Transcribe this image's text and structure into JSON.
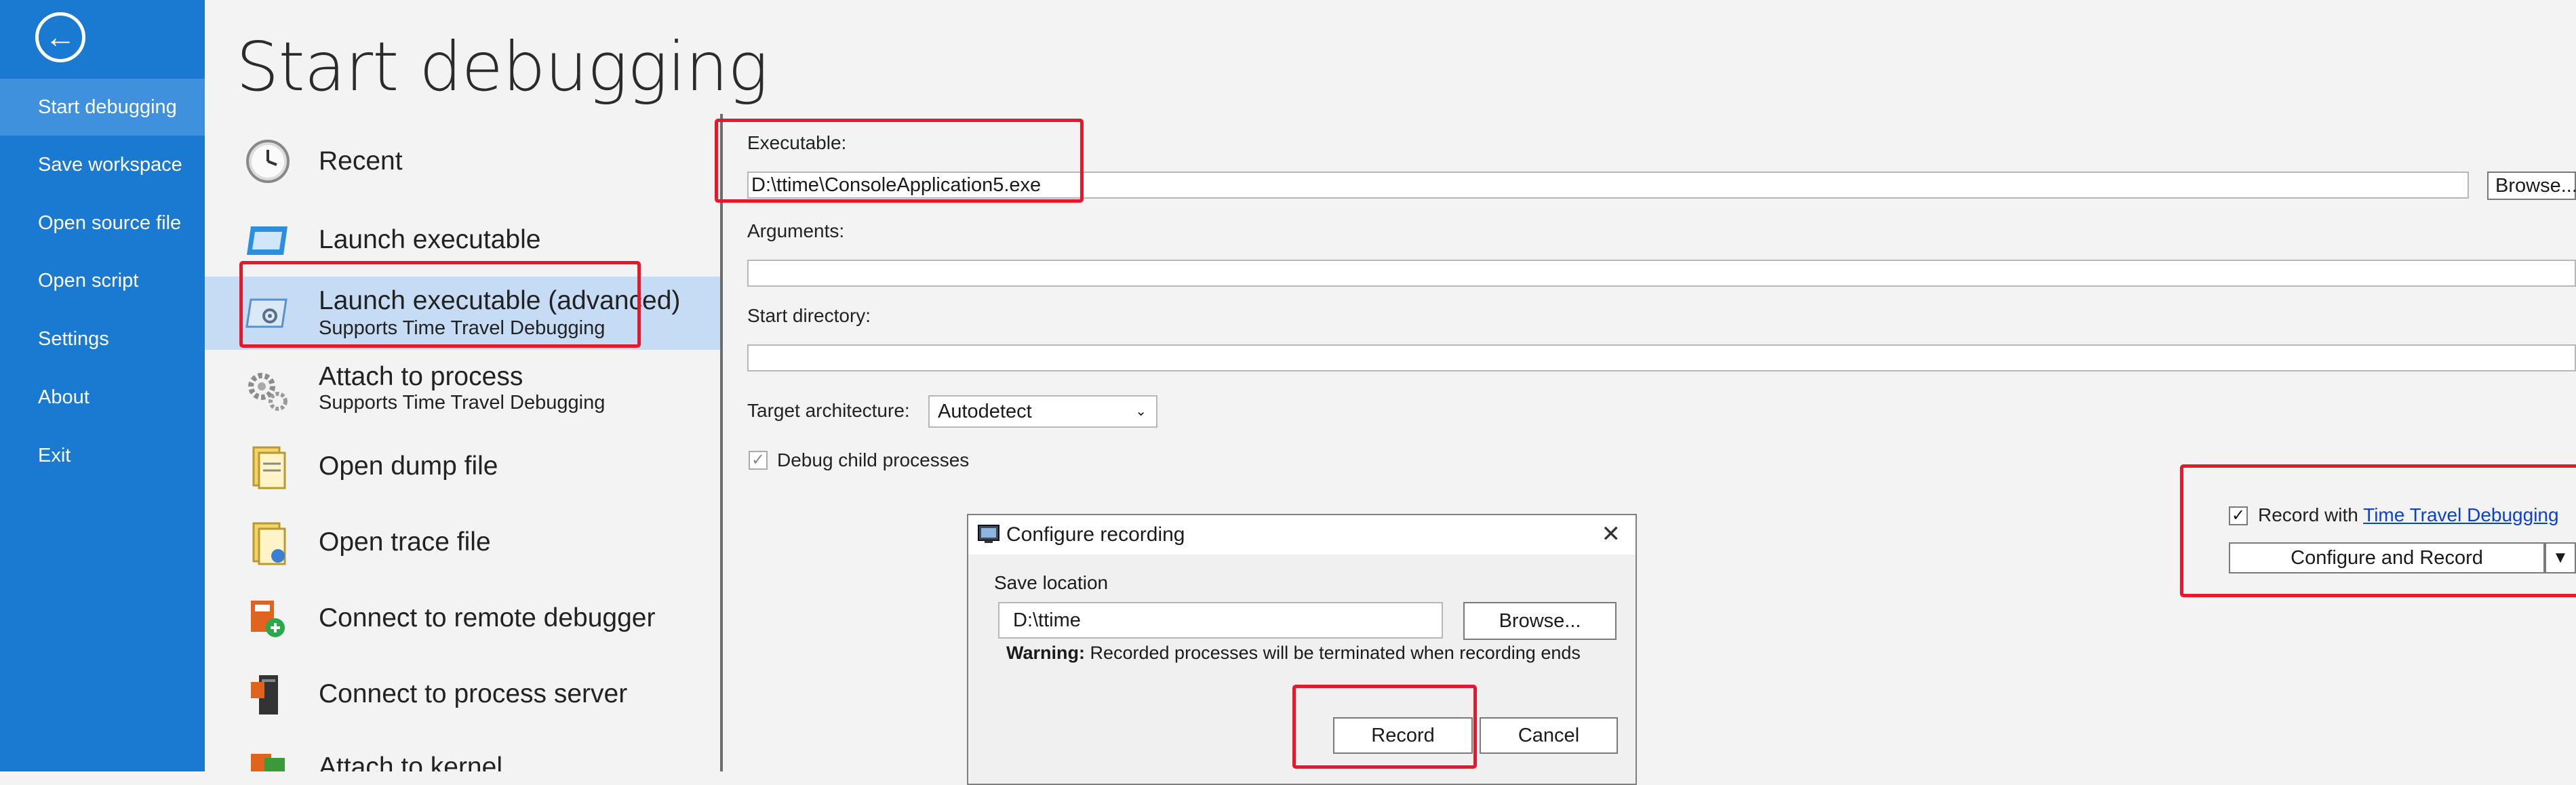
{
  "nav": {
    "items": [
      "Start debugging",
      "Save workspace",
      "Open source file",
      "Open script",
      "Settings",
      "About",
      "Exit"
    ],
    "active": "Start debugging"
  },
  "page_title": "Start debugging",
  "list": {
    "items": [
      {
        "label": "Recent",
        "sub": "",
        "icon": "clock-icon"
      },
      {
        "label": "Launch executable",
        "sub": "",
        "icon": "window-icon"
      },
      {
        "label": "Launch executable (advanced)",
        "sub": "Supports Time Travel Debugging",
        "icon": "window-gear-icon"
      },
      {
        "label": "Attach to process",
        "sub": "Supports Time Travel Debugging",
        "icon": "gears-icon"
      },
      {
        "label": "Open dump file",
        "sub": "",
        "icon": "dump-file-icon"
      },
      {
        "label": "Open trace file",
        "sub": "",
        "icon": "trace-file-icon"
      },
      {
        "label": "Connect to remote debugger",
        "sub": "",
        "icon": "remote-debugger-icon"
      },
      {
        "label": "Connect to process server",
        "sub": "",
        "icon": "process-server-icon"
      },
      {
        "label": "Attach to kernel",
        "sub": "",
        "icon": "kernel-icon"
      }
    ]
  },
  "form": {
    "executable_label": "Executable:",
    "executable_value": "D:\\ttime\\ConsoleApplication5.exe",
    "browse_label": "Browse...",
    "arguments_label": "Arguments:",
    "arguments_value": "",
    "start_dir_label": "Start directory:",
    "start_dir_value": "",
    "target_arch_label": "Target architecture:",
    "target_arch_value": "Autodetect",
    "debug_child_label": "Debug child processes",
    "debug_child_checked": true,
    "record_with_label": "Record with",
    "ttd_link": "Time Travel Debugging",
    "record_checked": true,
    "configure_record_label": "Configure and Record"
  },
  "dialog": {
    "title": "Configure recording",
    "save_location_label": "Save location",
    "save_location_value": "D:\\ttime",
    "browse_label": "Browse...",
    "warning_bold": "Warning:",
    "warning_text": " Recorded processes will be terminated when recording ends",
    "record_label": "Record",
    "cancel_label": "Cancel"
  },
  "colors": {
    "nav_bg": "#1a79d1",
    "nav_active": "#3f91dd",
    "selected_bg": "#c6dcf4",
    "highlight_red": "#e8182a",
    "link": "#0a40d6"
  }
}
